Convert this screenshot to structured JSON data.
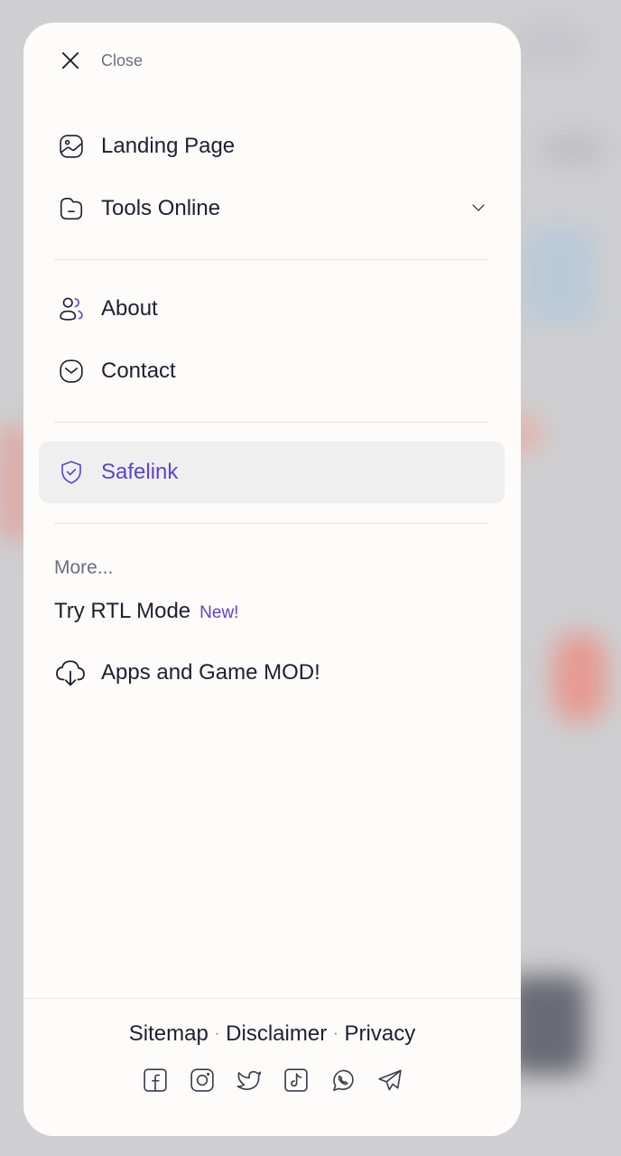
{
  "close": {
    "label": "Close",
    "icon": "close-icon"
  },
  "menu": {
    "primary": [
      {
        "label": "Landing Page",
        "icon": "image-icon"
      },
      {
        "label": "Tools Online",
        "icon": "folder-icon",
        "has_submenu": true
      }
    ],
    "secondary": [
      {
        "label": "About",
        "icon": "users-icon"
      },
      {
        "label": "Contact",
        "icon": "mail-icon"
      }
    ],
    "active": {
      "label": "Safelink",
      "icon": "shield-check-icon"
    }
  },
  "more": {
    "title": "More...",
    "rtl_label": "Try RTL Mode",
    "rtl_badge": "New!",
    "apps_label": "Apps and Game MOD!",
    "apps_icon": "cloud-download-icon"
  },
  "footer": {
    "links": [
      "Sitemap",
      "Disclaimer",
      "Privacy"
    ],
    "separator": "·",
    "social_icons": [
      "facebook-icon",
      "instagram-icon",
      "twitter-icon",
      "tiktok-icon",
      "whatsapp-icon",
      "telegram-icon"
    ]
  },
  "colors": {
    "accent": "#5b43d6",
    "text": "#1d2030",
    "muted": "#6b6f80",
    "panel": "#fdfcfa",
    "active_bg": "#f0efef"
  }
}
